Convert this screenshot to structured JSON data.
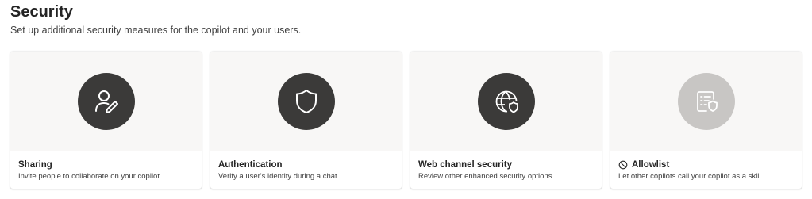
{
  "header": {
    "title": "Security",
    "subtitle": "Set up additional security measures for the copilot and your users."
  },
  "cards": [
    {
      "title": "Sharing",
      "description": "Invite people to collaborate on your copilot.",
      "icon": "person-edit-icon"
    },
    {
      "title": "Authentication",
      "description": "Verify a user's identity during a chat.",
      "icon": "shield-icon"
    },
    {
      "title": "Web channel security",
      "description": "Review other enhanced security options.",
      "icon": "globe-shield-icon"
    },
    {
      "title": "Allowlist",
      "description": "Let other copilots call your copilot as a skill.",
      "icon": "document-shield-icon",
      "status_icon": "prohibited-icon",
      "disabled": true
    }
  ],
  "colors": {
    "icon_circle": "#3b3a39",
    "icon_circle_disabled": "#c8c6c4",
    "hero_background": "#f8f7f6"
  }
}
